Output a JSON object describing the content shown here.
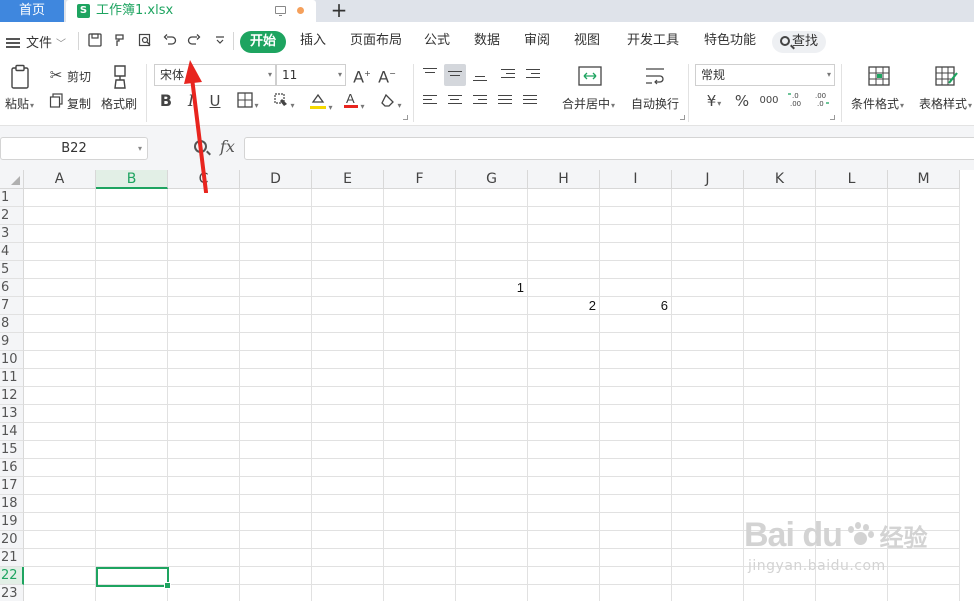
{
  "tabs": {
    "home_label": "首页",
    "file_label": "工作簿1.xlsx",
    "file_icon_letter": "S",
    "add_tab": "+"
  },
  "menu": {
    "file_label": "文件",
    "tabs": [
      "开始",
      "插入",
      "页面布局",
      "公式",
      "数据",
      "审阅",
      "视图",
      "开发工具",
      "特色功能"
    ],
    "active_tab": "开始",
    "search_label": "查找"
  },
  "ribbon": {
    "paste_label": "粘贴",
    "cut_label": "剪切",
    "copy_label": "复制",
    "format_painter_label": "格式刷",
    "font_name": "宋体",
    "font_size": "11",
    "merge_center_label": "合并居中",
    "wrap_text_label": "自动换行",
    "number_format": "常规",
    "currency_symbol": "¥",
    "percent_symbol": "%",
    "thousands_symbol": "000",
    "cond_format_label": "条件格式",
    "table_style_label": "表格样式",
    "bold": "B",
    "italic": "I",
    "underline": "U"
  },
  "formula_bar": {
    "name_box": "B22",
    "fx": "fx",
    "formula": ""
  },
  "grid": {
    "columns": [
      "A",
      "B",
      "C",
      "D",
      "E",
      "F",
      "G",
      "H",
      "I",
      "J",
      "K",
      "L",
      "M"
    ],
    "rows": [
      "1",
      "2",
      "3",
      "4",
      "5",
      "6",
      "7",
      "8",
      "9",
      "10",
      "11",
      "12",
      "13",
      "14",
      "15",
      "16",
      "17",
      "18",
      "19",
      "20",
      "21",
      "22",
      "23"
    ],
    "selected_column": "B",
    "selected_row": "22",
    "cells": [
      {
        "ref": "G6",
        "value": "1"
      },
      {
        "ref": "H7",
        "value": "2"
      },
      {
        "ref": "I7",
        "value": "6"
      }
    ]
  },
  "colors": {
    "accent_green": "#1ea460",
    "home_tab_blue": "#3f87de",
    "arrow_red": "#e8251f"
  },
  "watermark": {
    "brand": "Bai du",
    "cn": "经验",
    "url": "jingyan.baidu.com"
  }
}
